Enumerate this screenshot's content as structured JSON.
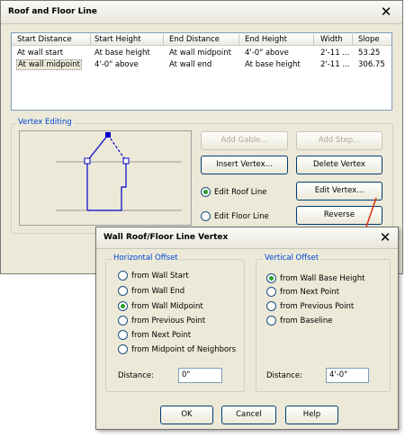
{
  "main_dialog": {
    "title": "Roof and Floor Line",
    "columns": [
      "Start Distance",
      "Start Height",
      "End Distance",
      "End Height",
      "Width",
      "Slope"
    ],
    "rows": [
      [
        "At wall start",
        "At base height",
        "At wall midpoint",
        "4'-0\" above",
        "2'-11 ...",
        "53.25"
      ],
      [
        "At wall midpoint",
        "4'-0\" above",
        "At wall end",
        "At base height",
        "2'-11 ...",
        "306.75"
      ]
    ],
    "vertex_group_label": "Vertex Editing",
    "buttons": {
      "add_gable": "Add Gable...",
      "add_step": "Add Step...",
      "insert_vertex": "Insert Vertex...",
      "delete_vertex": "Delete Vertex",
      "edit_vertex": "Edit Vertex...",
      "reverse": "Reverse"
    },
    "radios": {
      "edit_roof_line": "Edit Roof Line",
      "edit_floor_line": "Edit Floor Line",
      "selected": "edit_roof_line"
    }
  },
  "sub_dialog": {
    "title": "Wall Roof/Floor Line Vertex",
    "horizontal": {
      "label": "Horizontal Offset",
      "options": [
        "from Wall Start",
        "from Wall End",
        "from Wall Midpoint",
        "from Previous Point",
        "from Next Point",
        "from Midpoint of Neighbors"
      ],
      "selected_index": 2,
      "distance_label": "Distance:",
      "distance_value": "0\""
    },
    "vertical": {
      "label": "Vertical Offset",
      "options": [
        "from Wall Base Height",
        "from Next Point",
        "from Previous Point",
        "from Baseline"
      ],
      "selected_index": 0,
      "distance_label": "Distance:",
      "distance_value": "4'-0\""
    },
    "buttons": {
      "ok": "OK",
      "cancel": "Cancel",
      "help": "Help"
    }
  },
  "colors": {
    "dialog_bg": "#ece9d8",
    "group_label": "#0046d5",
    "radio_dot": "#2a9b2a",
    "arrow": "#e03010",
    "preview_line": "#0000cc"
  }
}
